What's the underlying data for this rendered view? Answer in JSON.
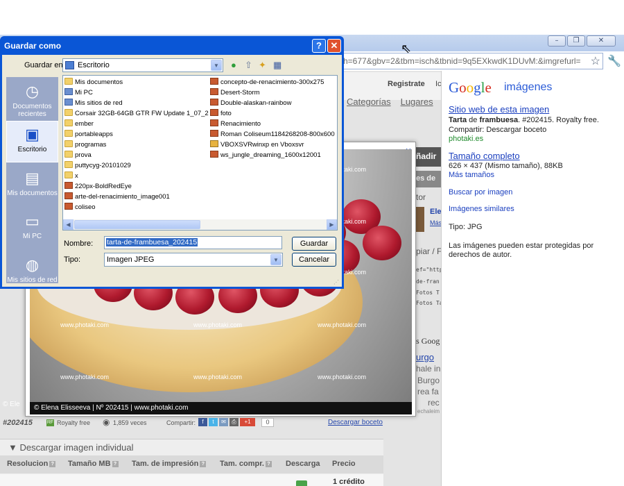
{
  "browser": {
    "window_controls": {
      "minimize": "–",
      "maximize": "❐",
      "close": "✕"
    },
    "address_text": "h=677&gbv=2&tbm=isch&tbnid=9q5EXkwdK1DUvM:&imgrefurl=",
    "icons": [
      "star-icon",
      "wrench-icon",
      "mouse-cursor-icon"
    ]
  },
  "page": {
    "registrate": "Registrate",
    "ic_fragment": "Ic",
    "nav": {
      "categorias": "Categorías",
      "lugares": "Lugares"
    },
    "side": {
      "anadir": "ñadir",
      "es_de": "es de",
      "tor": "tor",
      "ele": "Ele",
      "mas": "Más",
      "piar": "piar / F",
      "href_line": "ef=\"http",
      "de_fran": "de-fran",
      "fotos1": "Fotos T",
      "fotos2": "Fotos Ta",
      "goog": "s Goog",
      "urgo": "urgo",
      "hale": "hale in",
      "burgo": "Burgo",
      "rea": "rea fa",
      "rec": "rec",
      "echaleim": "echaleim"
    },
    "preview": {
      "close_label": "×",
      "credit": "© Elena Elisseeva | Nº 202415 | www.photaki.com",
      "credit_left": "© Ele",
      "watermark": "www.photaki.com"
    },
    "info": {
      "id": "#202415",
      "rf_badge": "RF",
      "royalty": "Royalty free",
      "views": "1,859 veces",
      "share": "Compartir:",
      "count": "0",
      "boceto": "Descargar boceto"
    },
    "download": {
      "title": "▼ Descargar imagen individual",
      "columns": [
        "Resolucion",
        "Tamaño MB",
        "Tam. de impresión",
        "Tam. compr.",
        "Descarga",
        "Precio"
      ],
      "credito": "1 crédito"
    }
  },
  "google_panel": {
    "logo": [
      "G",
      "o",
      "o",
      "g",
      "l",
      "e"
    ],
    "imagenes": "imágenes",
    "sitio_link": "Sitio web de esta imagen",
    "title_bold1": "Tarta",
    "title_mid": " de ",
    "title_bold2": "frambuesa",
    "title_rest": ". #202415. Royalty free.",
    "compartir": "Compartir: Descargar boceto",
    "domain": "photaki.es",
    "tamano_link": "Tamaño completo",
    "tamano_info": "626 × 437 (Mismo tamaño), 88KB",
    "mas_tamanos": "Más tamaños",
    "buscar": "Buscar por imagen",
    "similares": "Imágenes similares",
    "tipo": "Tipo:  JPG",
    "disclaimer_1": "Las imágenes pueden estar protegidas por",
    "disclaimer_2": "derechos de autor."
  },
  "save_dialog": {
    "title": "Guardar como",
    "help": "?",
    "close": "✕",
    "guardar_en_label": "Guardar en:",
    "guardar_en_value": "Escritorio",
    "places": [
      {
        "label": "Documentos recientes",
        "icon": "recent-documents-icon"
      },
      {
        "label": "Escritorio",
        "icon": "desktop-icon"
      },
      {
        "label": "Mis documentos",
        "icon": "my-documents-icon"
      },
      {
        "label": "Mi PC",
        "icon": "my-computer-icon"
      },
      {
        "label": "Mis sitios de red",
        "icon": "network-places-icon"
      }
    ],
    "files_col1": [
      {
        "name": "Mis documentos",
        "kind": "folder"
      },
      {
        "name": "Mi PC",
        "kind": "sys"
      },
      {
        "name": "Mis sitios de red",
        "kind": "sys"
      },
      {
        "name": "Corsair 32GB-64GB GTR FW Update 1_07_2",
        "kind": "folder"
      },
      {
        "name": "ember",
        "kind": "folder"
      },
      {
        "name": "portableapps",
        "kind": "folder"
      },
      {
        "name": "programas",
        "kind": "folder"
      },
      {
        "name": "prova",
        "kind": "folder"
      },
      {
        "name": "puttycyg-20101029",
        "kind": "folder"
      },
      {
        "name": "x",
        "kind": "folder"
      },
      {
        "name": "220px-BoldRedEye",
        "kind": "img"
      },
      {
        "name": "arte-del-renacimiento_image001",
        "kind": "img"
      },
      {
        "name": "coliseo",
        "kind": "img"
      }
    ],
    "files_col2": [
      {
        "name": "concepto-de-renacimiento-300x275",
        "kind": "img"
      },
      {
        "name": "Desert-Storm",
        "kind": "img"
      },
      {
        "name": "Double-alaskan-rainbow",
        "kind": "img"
      },
      {
        "name": "foto",
        "kind": "img"
      },
      {
        "name": "Renacimiento",
        "kind": "img"
      },
      {
        "name": "Roman Coliseum1184268208-800x600",
        "kind": "img"
      },
      {
        "name": "VBOXSVRwinxp en Vboxsvr",
        "kind": "lnk"
      },
      {
        "name": "ws_jungle_dreaming_1600x12001",
        "kind": "img"
      }
    ],
    "nombre_label": "Nombre:",
    "nombre_value": "tarta-de-frambuesa_202415",
    "tipo_label": "Tipo:",
    "tipo_value": "Imagen JPEG",
    "guardar_button": "Guardar",
    "cancelar_button": "Cancelar"
  }
}
